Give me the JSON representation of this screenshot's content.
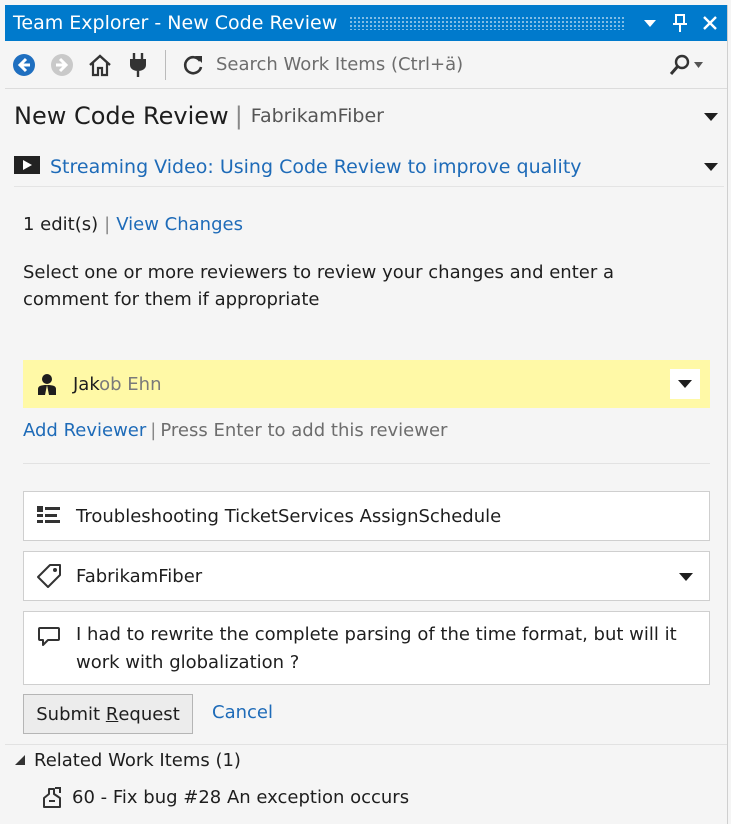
{
  "window": {
    "title": "Team Explorer - New Code Review",
    "buttons": [
      "chevron-down-icon",
      "pin-icon",
      "close-icon"
    ]
  },
  "toolbar": {
    "icons": [
      "back-icon",
      "forward-icon",
      "home-icon",
      "connect-icon",
      "refresh-icon"
    ],
    "search_placeholder": "Search Work Items (Ctrl+ä)"
  },
  "header": {
    "title": "New Code Review",
    "project": "FabrikamFiber"
  },
  "video": {
    "label": "Streaming Video: Using Code Review to improve quality"
  },
  "changes": {
    "edits": "1 edit(s)",
    "view_changes": "View Changes"
  },
  "instructions": "Select one or more reviewers to review your changes and enter a comment for them if appropriate",
  "reviewer": {
    "typed": "Jak",
    "suggestion": "ob Ehn"
  },
  "add_reviewer": {
    "label": "Add Reviewer",
    "hint": "Press Enter to add this reviewer"
  },
  "form": {
    "title_value": "Troubleshooting TicketServices AssignSchedule",
    "team_value": "FabrikamFiber",
    "comment_value": "I had to rewrite the complete parsing of the time format, but will it work with globalization ?"
  },
  "actions": {
    "submit_pre": "Submit ",
    "submit_underline": "R",
    "submit_post": "equest",
    "cancel": "Cancel"
  },
  "related": {
    "header": "Related Work Items (1)",
    "items": [
      "60 - Fix bug #28 An exception occurs"
    ]
  },
  "colors": {
    "accent": "#007acc",
    "link": "#1e6bb8",
    "reviewer_highlight": "#fff9a6",
    "background": "#f5f5f5"
  }
}
